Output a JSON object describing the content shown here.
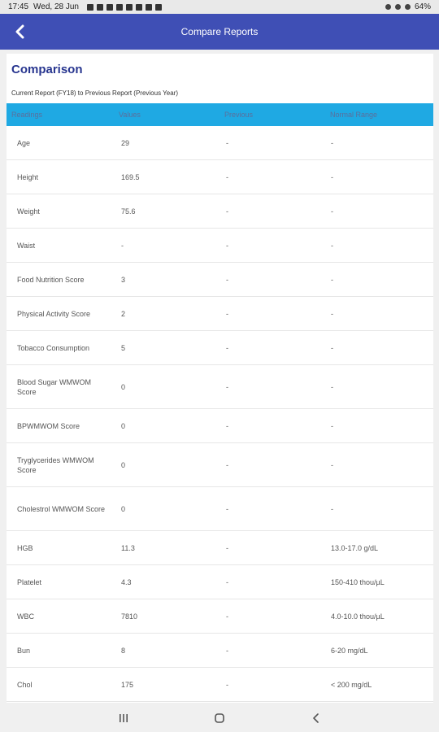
{
  "status_bar": {
    "time": "17:45",
    "date": "Wed, 28 Jun",
    "battery": "64%"
  },
  "app_bar": {
    "title": "Compare Reports",
    "back_icon": "chevron-left-icon"
  },
  "card": {
    "heading": "Comparison",
    "subheading": "Current Report (FY18) to Previous Report (Previous Year)"
  },
  "table": {
    "headers": [
      "Readings",
      "Values",
      "Previous",
      "Normal Range"
    ],
    "rows": [
      {
        "reading": "Age",
        "value": "29",
        "previous": "-",
        "range": "-"
      },
      {
        "reading": "Height",
        "value": "169.5",
        "previous": "-",
        "range": "-"
      },
      {
        "reading": "Weight",
        "value": "75.6",
        "previous": "-",
        "range": "-"
      },
      {
        "reading": "Waist",
        "value": "-",
        "previous": "-",
        "range": "-"
      },
      {
        "reading": "Food Nutrition Score",
        "value": "3",
        "previous": "-",
        "range": "-"
      },
      {
        "reading": "Physical Activity Score",
        "value": "2",
        "previous": "-",
        "range": "-"
      },
      {
        "reading": "Tobacco Consumption",
        "value": "5",
        "previous": "-",
        "range": "-"
      },
      {
        "reading": "Blood Sugar WMWOM Score",
        "value": "0",
        "previous": "-",
        "range": "-"
      },
      {
        "reading": "BPWMWOM Score",
        "value": "0",
        "previous": "-",
        "range": "-"
      },
      {
        "reading": "Tryglycerides WMWOM Score",
        "value": "0",
        "previous": "-",
        "range": "-"
      },
      {
        "reading": "Cholestrol WMWOM Score",
        "value": "0",
        "previous": "-",
        "range": "-"
      },
      {
        "reading": "HGB",
        "value": "11.3",
        "previous": "-",
        "range": "13.0-17.0 g/dL"
      },
      {
        "reading": "Platelet",
        "value": "4.3",
        "previous": "-",
        "range": "150-410 thou/µL"
      },
      {
        "reading": "WBC",
        "value": "7810",
        "previous": "-",
        "range": "4.0-10.0 thou/µL"
      },
      {
        "reading": "Bun",
        "value": "8",
        "previous": "-",
        "range": "6-20 mg/dL"
      },
      {
        "reading": "Chol",
        "value": "175",
        "previous": "-",
        "range": "< 200 mg/dL"
      }
    ]
  },
  "nav_bar": {
    "recents_icon": "recents-icon",
    "home_icon": "home-icon",
    "back_icon": "back-icon"
  }
}
